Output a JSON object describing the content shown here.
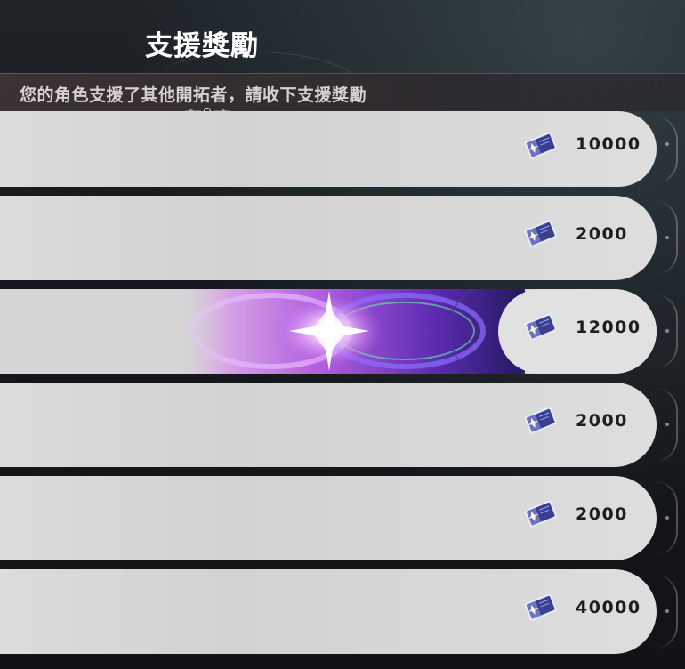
{
  "header": {
    "title": "支援獎勵",
    "subtitle": "您的角色支援了其他開拓者，請收下支援獎勵"
  },
  "rewards": [
    {
      "icon": "ticket-icon",
      "amount": "10000",
      "highlighted": false
    },
    {
      "icon": "ticket-icon",
      "amount": "2000",
      "highlighted": false
    },
    {
      "icon": "ticket-icon",
      "amount": "12000",
      "highlighted": true
    },
    {
      "icon": "ticket-icon",
      "amount": "2000",
      "highlighted": false
    },
    {
      "icon": "ticket-icon",
      "amount": "2000",
      "highlighted": false
    },
    {
      "icon": "ticket-icon",
      "amount": "40000",
      "highlighted": false
    }
  ],
  "colors": {
    "row_background": "#d8d8d8",
    "amount_text": "#1e1e1e",
    "highlight_purple": "#7a3cc8"
  }
}
